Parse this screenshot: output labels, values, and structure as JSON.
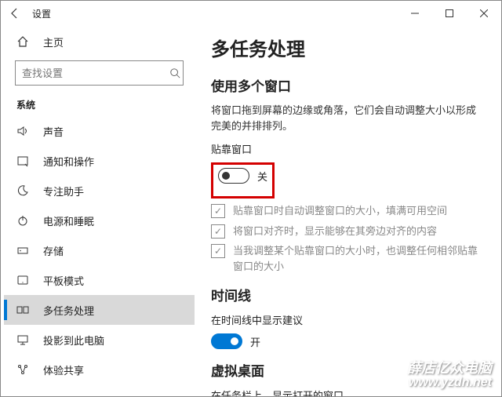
{
  "titlebar": {
    "title": "设置"
  },
  "sidebar": {
    "home": "主页",
    "search_placeholder": "查找设置",
    "category": "系统",
    "items": [
      {
        "label": "声音"
      },
      {
        "label": "通知和操作"
      },
      {
        "label": "专注助手"
      },
      {
        "label": "电源和睡眠"
      },
      {
        "label": "存储"
      },
      {
        "label": "平板模式"
      },
      {
        "label": "多任务处理"
      },
      {
        "label": "投影到此电脑"
      },
      {
        "label": "体验共享"
      }
    ]
  },
  "main": {
    "h1": "多任务处理",
    "snap": {
      "h2": "使用多个窗口",
      "desc": "将窗口拖到屏幕的边缘或角落，它们会自动调整大小以形成完美的并排排列。",
      "toggle_label": "贴靠窗口",
      "toggle_state": "关",
      "chk1": "贴靠窗口时自动调整窗口的大小，填满可用空间",
      "chk2": "将窗口对齐时，显示能够在其旁边对齐的内容",
      "chk3": "当我调整某个贴靠窗口的大小时，也调整任何相邻贴靠窗口的大小"
    },
    "timeline": {
      "h2": "时间线",
      "label": "在时间线中显示建议",
      "state": "开"
    },
    "vd": {
      "h2": "虚拟桌面",
      "label": "在任务栏上，显示打开的窗口"
    }
  },
  "watermark": {
    "line1": "薛店亿众电脑",
    "line2": "www.yzdn.net"
  }
}
